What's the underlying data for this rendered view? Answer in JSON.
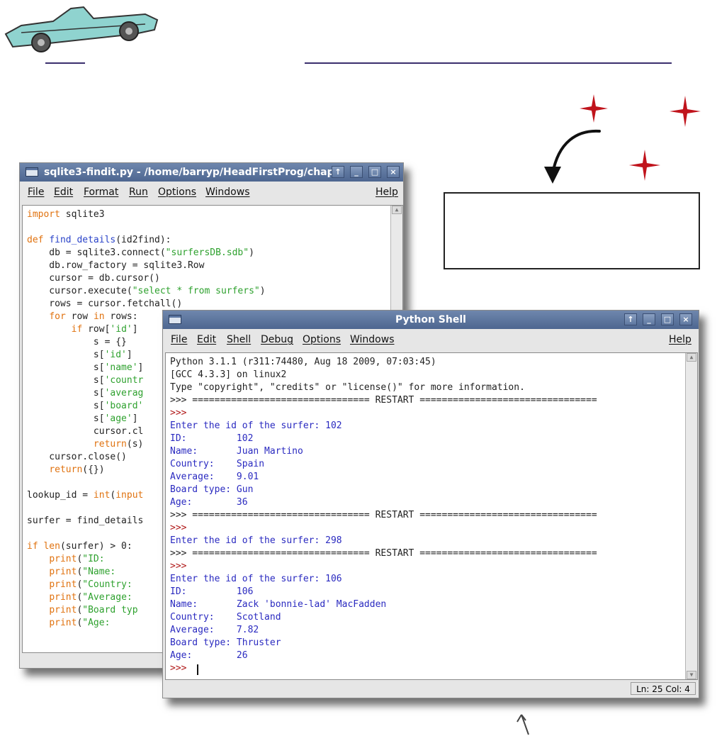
{
  "colors": {
    "title_bar": "#5a74a0",
    "keyword": "#e0720f",
    "string": "#2ea12e",
    "def_name": "#2a43c9",
    "output": "#2a2ac0",
    "prompt": "#b01818",
    "star": "#c0141c",
    "rule": "#3b2f6e"
  },
  "editor": {
    "title": "sqlite3-findit.py - /home/barryp/HeadFirstProg/chap",
    "menus": [
      "File",
      "Edit",
      "Format",
      "Run",
      "Options",
      "Windows"
    ],
    "help": "Help",
    "code_lines": [
      "import sqlite3",
      "",
      "def find_details(id2find):",
      "    db = sqlite3.connect(\"surfersDB.sdb\")",
      "    db.row_factory = sqlite3.Row",
      "    cursor = db.cursor()",
      "    cursor.execute(\"select * from surfers\")",
      "    rows = cursor.fetchall()",
      "    for row in rows:",
      "        if row['id']",
      "            s = {}",
      "            s['id']",
      "            s['name']",
      "            s['countr",
      "            s['averag",
      "            s['board'",
      "            s['age']",
      "            cursor.cl",
      "            return(s)",
      "    cursor.close()",
      "    return({})",
      "",
      "lookup_id = int(input",
      "",
      "surfer = find_details",
      "",
      "if len(surfer) > 0:",
      "    print(\"ID:",
      "    print(\"Name:",
      "    print(\"Country:",
      "    print(\"Average:",
      "    print(\"Board typ",
      "    print(\"Age:"
    ]
  },
  "shell": {
    "title": "Python Shell",
    "menus": [
      "File",
      "Edit",
      "Shell",
      "Debug",
      "Options",
      "Windows"
    ],
    "help": "Help",
    "lines": [
      "Python 3.1.1 (r311:74480, Aug 18 2009, 07:03:45)",
      "[GCC 4.3.3] on linux2",
      "Type \"copyright\", \"credits\" or \"license()\" for more information.",
      ">>> ================================ RESTART ================================",
      ">>>",
      "Enter the id of the surfer: 102",
      "ID:         102",
      "Name:       Juan Martino",
      "Country:    Spain",
      "Average:    9.01",
      "Board type: Gun",
      "Age:        36",
      ">>> ================================ RESTART ================================",
      ">>>",
      "Enter the id of the surfer: 298",
      ">>> ================================ RESTART ================================",
      ">>>",
      "Enter the id of the surfer: 106",
      "ID:         106",
      "Name:       Zack 'bonnie-lad' MacFadden",
      "Country:    Scotland",
      "Average:    7.82",
      "Board type: Thruster",
      "Age:        26",
      ">>> "
    ],
    "status": "Ln: 25 Col: 4"
  }
}
